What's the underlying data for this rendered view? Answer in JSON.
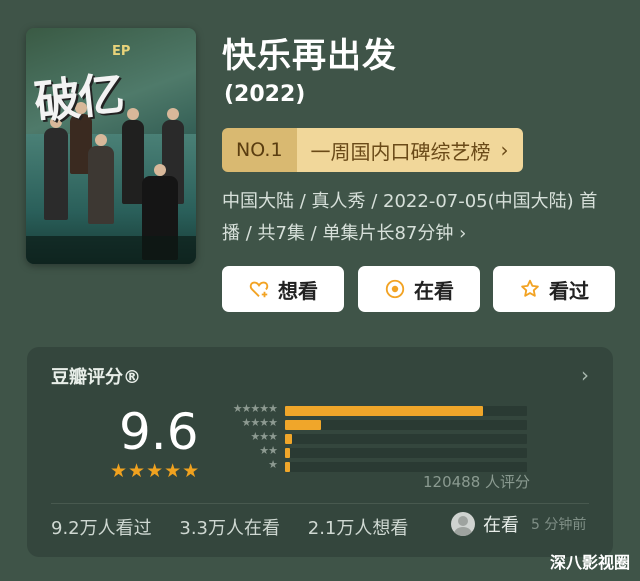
{
  "poster": {
    "title_art": "破亿",
    "ep_mark": "EP"
  },
  "show": {
    "title": "快乐再出发",
    "year": "(2022)"
  },
  "ranking": {
    "no": "NO.1",
    "list": "一周国内口碑综艺榜",
    "chevron": "›"
  },
  "meta": {
    "line1": "中国大陆 / 真人秀 / 2022-07-05(中国大陆) 首",
    "line2": "播 / 共7集 / 单集片长87分钟 ›"
  },
  "actions": [
    {
      "label": "想看",
      "icon": "heart-plus-icon"
    },
    {
      "label": "在看",
      "icon": "radio-target-icon"
    },
    {
      "label": "看过",
      "icon": "star-icon"
    }
  ],
  "rating": {
    "header": "豆瓣评分®",
    "score": "9.6",
    "stars": "★★★★★",
    "star_rows": [
      "★★★★★",
      "★★★★",
      "★★★",
      "★★",
      "★"
    ],
    "distribution": [
      0.82,
      0.15,
      0.03,
      0.02,
      0.02
    ],
    "count": "120488 人评分",
    "stats": {
      "watched": "9.2万人看过",
      "watching": "3.3万人在看",
      "want": "2.1万人想看"
    },
    "status_label": "在看",
    "status_time": "5 分钟前"
  },
  "watermark": "深八影视圈",
  "colors": {
    "background": "#3f5448",
    "accent": "#f0a62a",
    "rank_bg": "#f1d79a"
  }
}
